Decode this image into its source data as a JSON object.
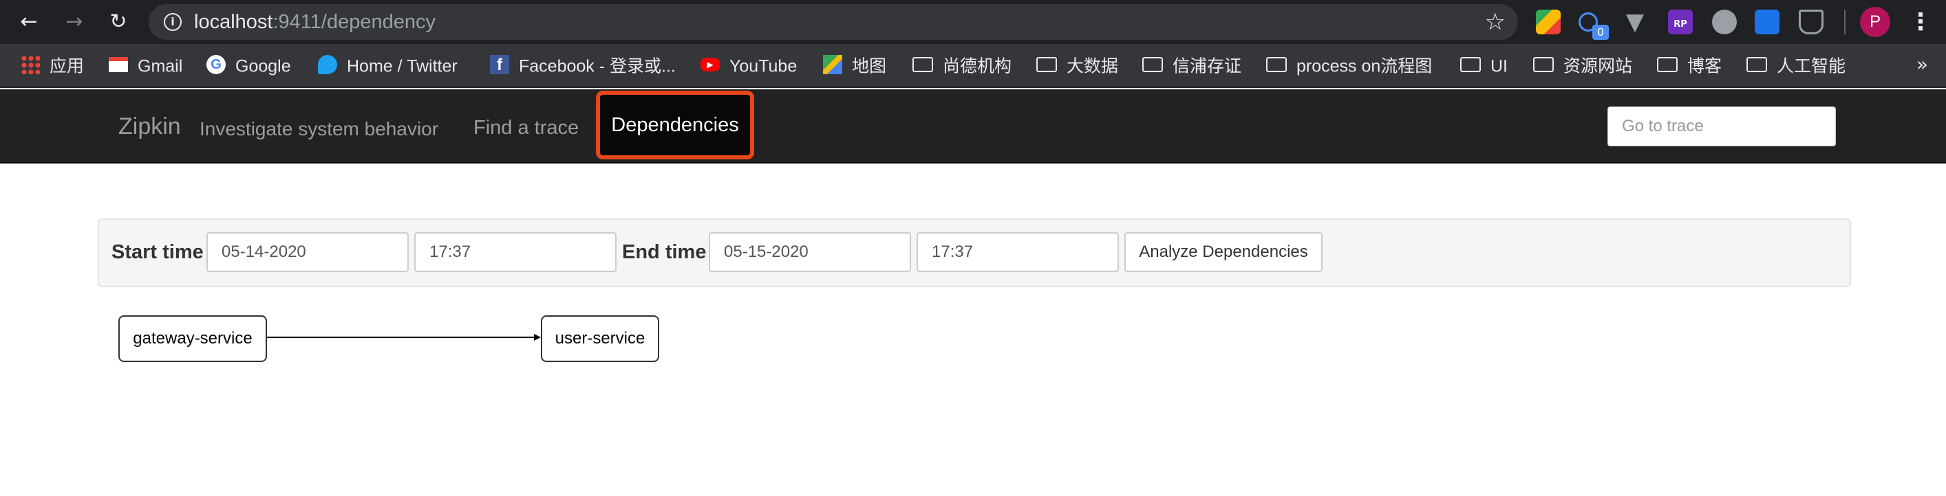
{
  "browser": {
    "url_host": "localhost",
    "url_path": ":9411/dependency",
    "avatar_letter": "P",
    "extension_badge": "0",
    "extension_rp": "RP",
    "more_bookmarks": "»"
  },
  "bookmarks": [
    {
      "label": "应用",
      "icon": "apps-grid-icon"
    },
    {
      "label": "Gmail",
      "icon": "gmail-icon"
    },
    {
      "label": "Google",
      "icon": "google-icon"
    },
    {
      "label": "Home / Twitter",
      "icon": "twitter-icon"
    },
    {
      "label": "Facebook - 登录或...",
      "icon": "facebook-icon"
    },
    {
      "label": "YouTube",
      "icon": "youtube-icon"
    },
    {
      "label": "地图",
      "icon": "maps-icon"
    },
    {
      "label": "尚德机构",
      "icon": "folder-icon"
    },
    {
      "label": "大数据",
      "icon": "folder-icon"
    },
    {
      "label": "信浦存证",
      "icon": "folder-icon"
    },
    {
      "label": "process on流程图",
      "icon": "folder-icon"
    },
    {
      "label": "UI",
      "icon": "folder-icon"
    },
    {
      "label": "资源网站",
      "icon": "folder-icon"
    },
    {
      "label": "博客",
      "icon": "folder-icon"
    },
    {
      "label": "人工智能",
      "icon": "folder-icon"
    }
  ],
  "zipkin": {
    "brand": "Zipkin",
    "tagline": "Investigate system behavior",
    "nav_find_trace": "Find a trace",
    "nav_dependencies": "Dependencies",
    "go_to_trace_placeholder": "Go to trace"
  },
  "filters": {
    "start_label": "Start time",
    "start_date": "05-14-2020",
    "start_time": "17:37",
    "end_label": "End time",
    "end_date": "05-15-2020",
    "end_time": "17:37",
    "analyze_button": "Analyze Dependencies"
  },
  "graph": {
    "nodes": [
      "gateway-service",
      "user-service"
    ],
    "edges": [
      {
        "from": "gateway-service",
        "to": "user-service"
      }
    ]
  },
  "colors": {
    "highlight": "#e8461b",
    "navbar": "#222222",
    "browser_chrome": "#202124"
  }
}
